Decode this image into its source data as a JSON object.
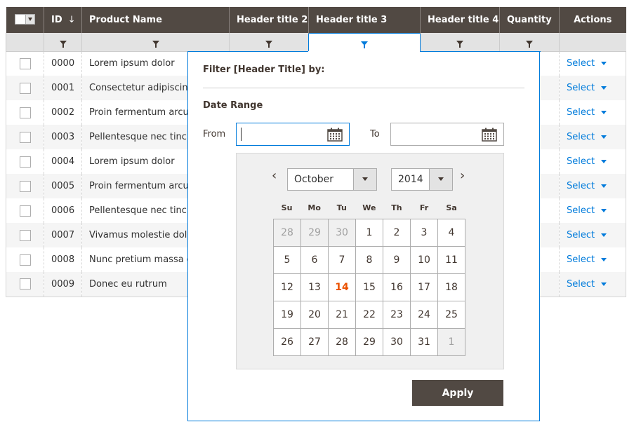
{
  "header": {
    "columns": [
      "ID",
      "Product Name",
      "Header title 2",
      "Header title 3",
      "Header title 4",
      "Quantity",
      "Actions"
    ],
    "sort_icon": "↓"
  },
  "rows": [
    {
      "id": "0000",
      "name": "Lorem ipsum dolor",
      "h2": "",
      "h3": "",
      "h4": "",
      "qty": "",
      "action": "Select"
    },
    {
      "id": "0001",
      "name": "Consectetur adipiscing",
      "h2": "",
      "h3": "",
      "h4": "",
      "qty": "",
      "action": "Select"
    },
    {
      "id": "0002",
      "name": "Proin fermentum arcu",
      "h2": "",
      "h3": "",
      "h4": "",
      "qty": "",
      "action": "Select"
    },
    {
      "id": "0003",
      "name": "Pellentesque nec tinci",
      "h2": "",
      "h3": "",
      "h4": "",
      "qty": "",
      "action": "Select"
    },
    {
      "id": "0004",
      "name": "Lorem ipsum dolor",
      "h2": "",
      "h3": "",
      "h4": "",
      "qty": "",
      "action": "Select"
    },
    {
      "id": "0005",
      "name": "Proin fermentum arcu",
      "h2": "",
      "h3": "",
      "h4": "",
      "qty": "",
      "action": "Select"
    },
    {
      "id": "0006",
      "name": "Pellentesque nec tinci",
      "h2": "",
      "h3": "",
      "h4": "",
      "qty": "",
      "action": "Select"
    },
    {
      "id": "0007",
      "name": "Vivamus molestie dolo",
      "h2": "",
      "h3": "",
      "h4": "",
      "qty": "",
      "action": "Select"
    },
    {
      "id": "0008",
      "name": "Nunc pretium massa d",
      "h2": "",
      "h3": "",
      "h4": "",
      "qty": "",
      "action": "Select"
    },
    {
      "id": "0009",
      "name": "Donec eu rutrum",
      "h2": "",
      "h3": "",
      "h4": "",
      "qty": "",
      "action": "Select"
    }
  ],
  "filter_popup": {
    "title": "Filter [Header Title] by:",
    "section": "Date Range",
    "from_label": "From",
    "to_label": "To",
    "from_value": "",
    "to_value": "",
    "calendar": {
      "month": "October",
      "year": "2014",
      "weekdays": [
        "Su",
        "Mo",
        "Tu",
        "We",
        "Th",
        "Fr",
        "Sa"
      ],
      "weeks": [
        [
          "28",
          "29",
          "30",
          "1",
          "2",
          "3",
          "4"
        ],
        [
          "5",
          "6",
          "7",
          "8",
          "9",
          "10",
          "11"
        ],
        [
          "12",
          "13",
          "14",
          "15",
          "16",
          "17",
          "18"
        ],
        [
          "19",
          "20",
          "21",
          "22",
          "23",
          "24",
          "25"
        ],
        [
          "26",
          "27",
          "28",
          "29",
          "30",
          "31",
          "1"
        ]
      ],
      "today": "14"
    },
    "apply_label": "Apply"
  },
  "colors": {
    "header_bg": "#514943",
    "link": "#007bdb",
    "today": "#eb5202",
    "apply_bg": "#514943"
  }
}
